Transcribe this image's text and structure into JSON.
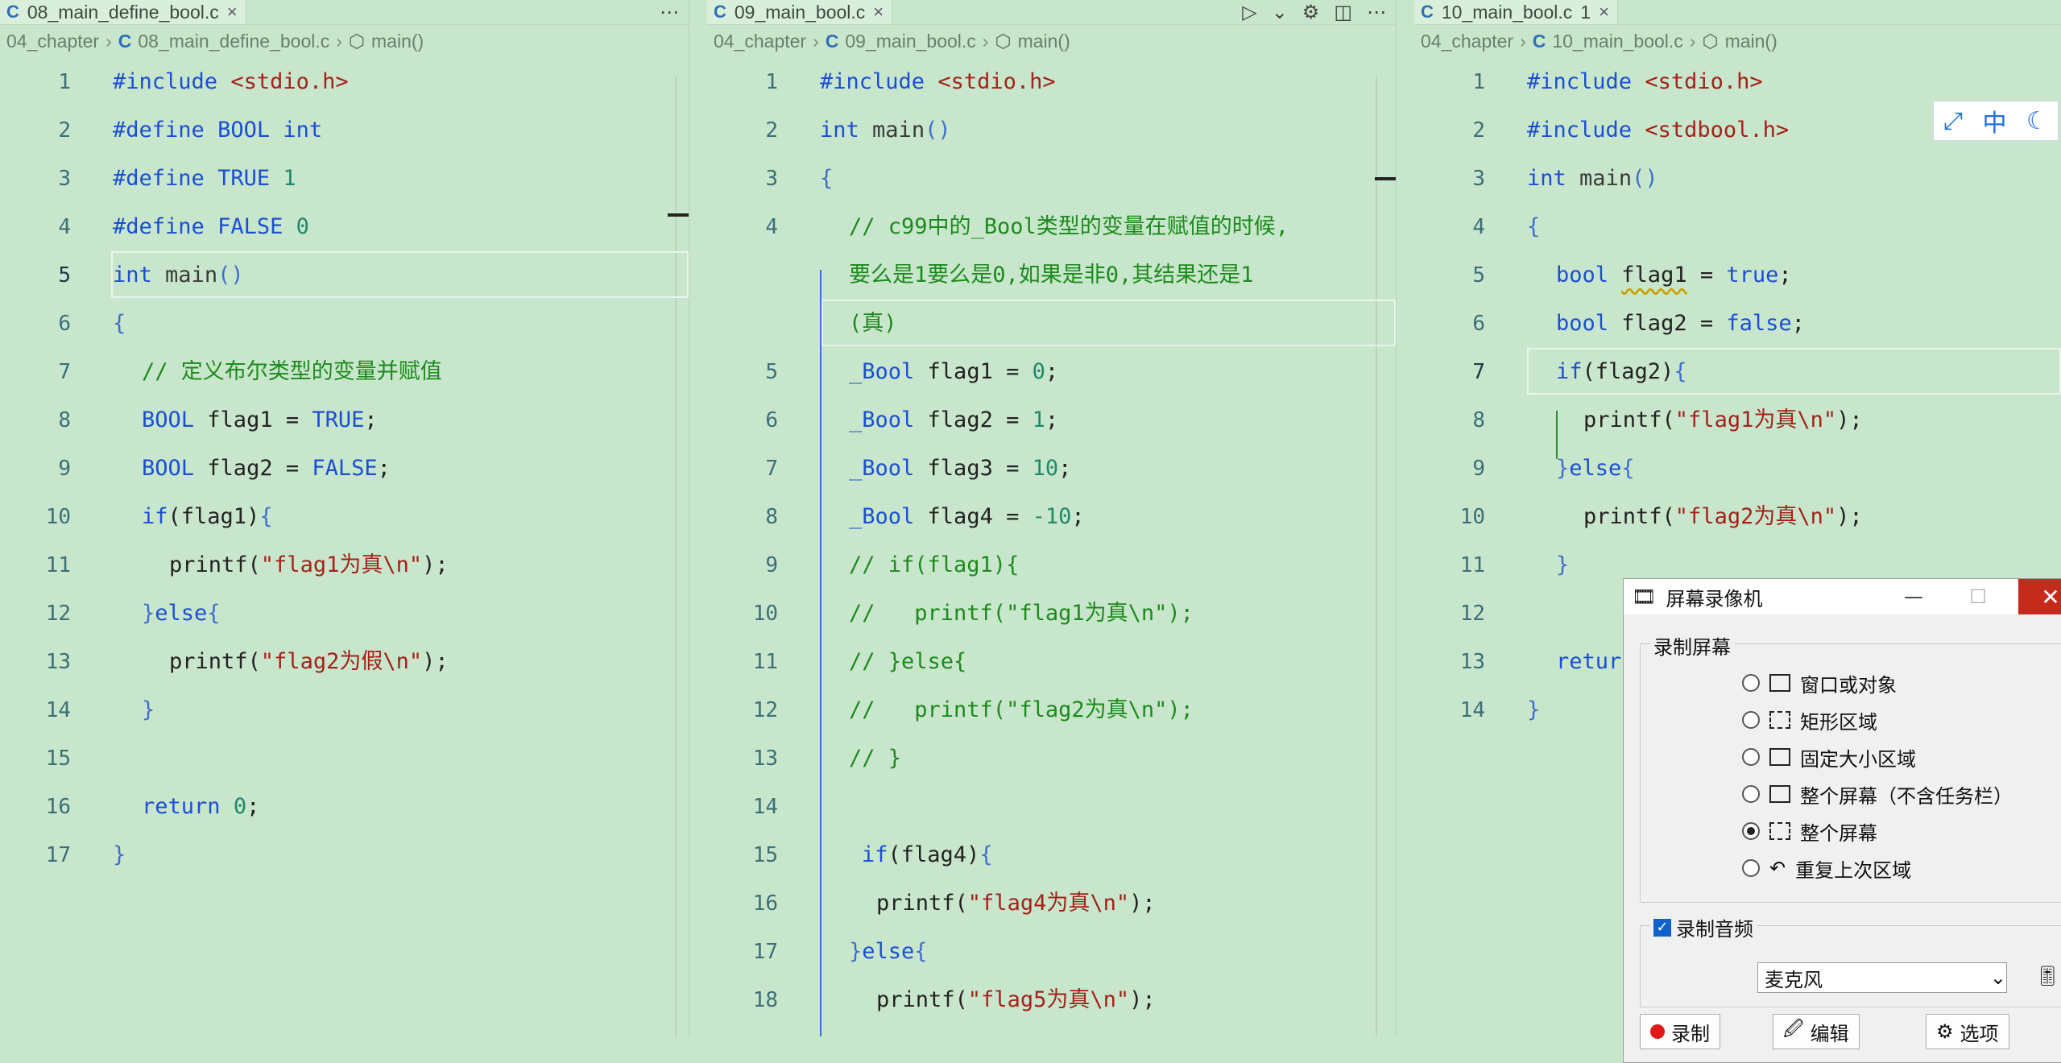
{
  "panes": [
    {
      "tab": {
        "name": "08_main_define_bool.c",
        "lang": "C",
        "close": "×"
      },
      "actions": [
        "⋯"
      ],
      "crumbs": {
        "folder": "04_chapter",
        "file": "08_main_define_bool.c",
        "symbol": "main()"
      }
    },
    {
      "tab": {
        "name": "09_main_bool.c",
        "lang": "C",
        "close": "×"
      },
      "actions": [
        "▷",
        "⌄",
        "⚙",
        "◫",
        "⋯"
      ],
      "crumbs": {
        "folder": "04_chapter",
        "file": "09_main_bool.c",
        "symbol": "main()"
      }
    },
    {
      "tab": {
        "name": "10_main_bool.c",
        "lang": "C",
        "badge": "1",
        "close": "×"
      },
      "crumbs": {
        "folder": "04_chapter",
        "file": "10_main_bool.c",
        "symbol": "main()"
      }
    }
  ],
  "code1": {
    "numbers": [
      "1",
      "2",
      "3",
      "4",
      "5",
      "6",
      "7",
      "8",
      "9",
      "10",
      "11",
      "12",
      "13",
      "14",
      "15",
      "16",
      "17"
    ],
    "l1": [
      "#include",
      "<stdio.h>"
    ],
    "l2": [
      "#define",
      "BOOL",
      "int"
    ],
    "l3": [
      "#define",
      "TRUE",
      "1"
    ],
    "l4": [
      "#define",
      "FALSE",
      "0"
    ],
    "l5": [
      "int",
      "main",
      "()"
    ],
    "l6": "{",
    "l7": "// 定义布尔类型的变量并赋值",
    "l8": [
      "BOOL",
      "flag1",
      "=",
      "TRUE",
      ";"
    ],
    "l9": [
      "BOOL",
      "flag2",
      "=",
      "FALSE",
      ";"
    ],
    "l10": [
      "if",
      "(flag1)",
      "{"
    ],
    "l11": [
      "printf(",
      "\"flag1为真\\n\"",
      ");"
    ],
    "l12": [
      "}",
      "else",
      "{"
    ],
    "l13": [
      "printf(",
      "\"flag2为假\\n\"",
      ");"
    ],
    "l14": "}",
    "l16": [
      "return",
      "0",
      ";"
    ],
    "l17": "}"
  },
  "code2": {
    "numbers": [
      "1",
      "2",
      "3",
      "4",
      "",
      "",
      "5",
      "6",
      "7",
      "8",
      "9",
      "10",
      "11",
      "12",
      "13",
      "14",
      "15",
      "16",
      "17",
      "18"
    ],
    "l1": [
      "#include",
      "<stdio.h>"
    ],
    "l2": [
      "int",
      "main",
      "()"
    ],
    "l3": "{",
    "l4a": "// c99中的_Bool类型的变量在赋值的时候,",
    "l4b": "要么是1要么是0,如果是非0,其结果还是1",
    "l4c": "(真)",
    "l5": [
      "_Bool",
      "flag1",
      "=",
      "0",
      ";"
    ],
    "l6": [
      "_Bool",
      "flag2",
      "=",
      "1",
      ";"
    ],
    "l7": [
      "_Bool",
      "flag3",
      "=",
      "10",
      ";"
    ],
    "l8": [
      "_Bool",
      "flag4",
      "=",
      "-10",
      ";"
    ],
    "l9": "// if(flag1){",
    "l10": "//   printf(\"flag1为真\\n\");",
    "l11": "// }else{",
    "l12": "//   printf(\"flag2为真\\n\");",
    "l13": "// }",
    "l15": [
      "if",
      "(flag4)",
      "{"
    ],
    "l16": [
      "printf(",
      "\"flag4为真\\n\"",
      ");"
    ],
    "l17": [
      "}",
      "else",
      "{"
    ],
    "l18": [
      "printf(",
      "\"flag5为真\\n\"",
      ");"
    ]
  },
  "code3": {
    "numbers": [
      "1",
      "2",
      "3",
      "4",
      "5",
      "6",
      "7",
      "8",
      "9",
      "10",
      "11",
      "12",
      "13",
      "14"
    ],
    "l1": [
      "#include",
      "<stdio.h>"
    ],
    "l2": [
      "#include",
      "<stdbool.h>"
    ],
    "l3": [
      "int",
      "main",
      "()"
    ],
    "l4": "{",
    "l5": [
      "bool",
      "flag1",
      "=",
      "true",
      ";"
    ],
    "l6": [
      "bool",
      "flag2",
      "=",
      "false",
      ";"
    ],
    "l7": [
      "if",
      "(flag2)",
      "{"
    ],
    "l8": [
      "printf(",
      "\"flag1为真\\n\"",
      ");"
    ],
    "l9": [
      "}",
      "else",
      "{"
    ],
    "l10": [
      "printf(",
      "\"flag2为真\\n\"",
      ");"
    ],
    "l11": "}",
    "l13": "retur",
    "l14": "}"
  },
  "ime": {
    "mode": "中",
    "theme": "☾",
    "icon": "⤢"
  },
  "recorder": {
    "title": "屏幕录像机",
    "min": "—",
    "max": "☐",
    "close": "✕",
    "group_screen": "录制屏幕",
    "options": [
      "窗口或对象",
      "矩形区域",
      "固定大小区域",
      "整个屏幕（不含任务栏）",
      "整个屏幕",
      "重复上次区域"
    ],
    "selected": "整个屏幕",
    "audio_label": "录制音频",
    "audio_checked": true,
    "mic": "麦克风",
    "buttons": [
      "录制",
      "编辑",
      "选项"
    ]
  },
  "colors": {
    "background": "#c8e6cb",
    "keyword": "#1a4fd6",
    "string": "#a3221a",
    "number": "#1f8a6a",
    "comment": "#1d8a1d",
    "close_button": "#c42b1c"
  }
}
